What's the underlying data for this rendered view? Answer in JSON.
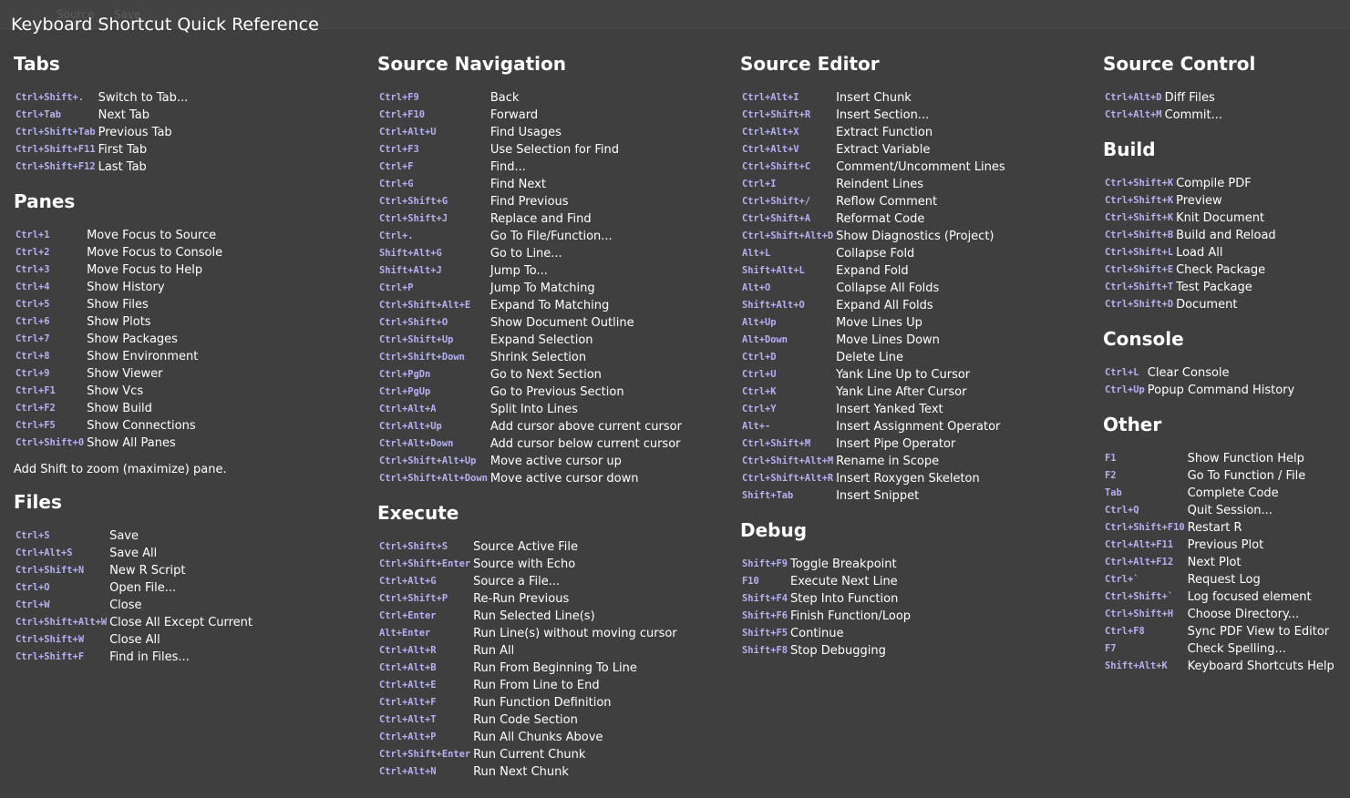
{
  "title": "Keyboard Shortcut Quick Reference",
  "ghost": {
    "source_label": "Source",
    "save_label": "Save"
  },
  "columns": [
    {
      "sections": [
        {
          "title": "Tabs",
          "items": [
            {
              "key": "Ctrl+Shift+.",
              "desc": "Switch to Tab..."
            },
            {
              "key": "Ctrl+Tab",
              "desc": "Next Tab"
            },
            {
              "key": "Ctrl+Shift+Tab",
              "desc": "Previous Tab"
            },
            {
              "key": "Ctrl+Shift+F11",
              "desc": "First Tab"
            },
            {
              "key": "Ctrl+Shift+F12",
              "desc": "Last Tab"
            }
          ]
        },
        {
          "title": "Panes",
          "items": [
            {
              "key": "Ctrl+1",
              "desc": "Move Focus to Source"
            },
            {
              "key": "Ctrl+2",
              "desc": "Move Focus to Console"
            },
            {
              "key": "Ctrl+3",
              "desc": "Move Focus to Help"
            },
            {
              "key": "Ctrl+4",
              "desc": "Show History"
            },
            {
              "key": "Ctrl+5",
              "desc": "Show Files"
            },
            {
              "key": "Ctrl+6",
              "desc": "Show Plots"
            },
            {
              "key": "Ctrl+7",
              "desc": "Show Packages"
            },
            {
              "key": "Ctrl+8",
              "desc": "Show Environment"
            },
            {
              "key": "Ctrl+9",
              "desc": "Show Viewer"
            },
            {
              "key": "Ctrl+F1",
              "desc": "Show Vcs"
            },
            {
              "key": "Ctrl+F2",
              "desc": "Show Build"
            },
            {
              "key": "Ctrl+F5",
              "desc": "Show Connections"
            },
            {
              "key": "Ctrl+Shift+0",
              "desc": "Show All Panes"
            }
          ],
          "note": "Add Shift to zoom (maximize) pane."
        },
        {
          "title": "Files",
          "items": [
            {
              "key": "Ctrl+S",
              "desc": "Save"
            },
            {
              "key": "Ctrl+Alt+S",
              "desc": "Save All"
            },
            {
              "key": "Ctrl+Shift+N",
              "desc": "New R Script"
            },
            {
              "key": "Ctrl+O",
              "desc": "Open File..."
            },
            {
              "key": "Ctrl+W",
              "desc": "Close"
            },
            {
              "key": "Ctrl+Shift+Alt+W",
              "desc": "Close All Except Current"
            },
            {
              "key": "Ctrl+Shift+W",
              "desc": "Close All"
            },
            {
              "key": "Ctrl+Shift+F",
              "desc": "Find in Files..."
            }
          ]
        }
      ]
    },
    {
      "sections": [
        {
          "title": "Source Navigation",
          "items": [
            {
              "key": "Ctrl+F9",
              "desc": "Back"
            },
            {
              "key": "Ctrl+F10",
              "desc": "Forward"
            },
            {
              "key": "Ctrl+Alt+U",
              "desc": "Find Usages"
            },
            {
              "key": "Ctrl+F3",
              "desc": "Use Selection for Find"
            },
            {
              "key": "Ctrl+F",
              "desc": "Find..."
            },
            {
              "key": "Ctrl+G",
              "desc": "Find Next"
            },
            {
              "key": "Ctrl+Shift+G",
              "desc": "Find Previous"
            },
            {
              "key": "Ctrl+Shift+J",
              "desc": "Replace and Find"
            },
            {
              "key": "Ctrl+.",
              "desc": "Go To File/Function..."
            },
            {
              "key": "Shift+Alt+G",
              "desc": "Go to Line..."
            },
            {
              "key": "Shift+Alt+J",
              "desc": "Jump To..."
            },
            {
              "key": "Ctrl+P",
              "desc": "Jump To Matching"
            },
            {
              "key": "Ctrl+Shift+Alt+E",
              "desc": "Expand To Matching"
            },
            {
              "key": "Ctrl+Shift+O",
              "desc": "Show Document Outline"
            },
            {
              "key": "Ctrl+Shift+Up",
              "desc": "Expand Selection"
            },
            {
              "key": "Ctrl+Shift+Down",
              "desc": "Shrink Selection"
            },
            {
              "key": "Ctrl+PgDn",
              "desc": "Go to Next Section"
            },
            {
              "key": "Ctrl+PgUp",
              "desc": "Go to Previous Section"
            },
            {
              "key": "Ctrl+Alt+A",
              "desc": "Split Into Lines"
            },
            {
              "key": "Ctrl+Alt+Up",
              "desc": "Add cursor above current cursor"
            },
            {
              "key": "Ctrl+Alt+Down",
              "desc": "Add cursor below current cursor"
            },
            {
              "key": "Ctrl+Shift+Alt+Up",
              "desc": "Move active cursor up"
            },
            {
              "key": "Ctrl+Shift+Alt+Down",
              "desc": "Move active cursor down"
            }
          ]
        },
        {
          "title": "Execute",
          "items": [
            {
              "key": "Ctrl+Shift+S",
              "desc": "Source Active File"
            },
            {
              "key": "Ctrl+Shift+Enter",
              "desc": "Source with Echo"
            },
            {
              "key": "Ctrl+Alt+G",
              "desc": "Source a File..."
            },
            {
              "key": "Ctrl+Shift+P",
              "desc": "Re-Run Previous"
            },
            {
              "key": "Ctrl+Enter",
              "desc": "Run Selected Line(s)"
            },
            {
              "key": "Alt+Enter",
              "desc": "Run Line(s) without moving cursor"
            },
            {
              "key": "Ctrl+Alt+R",
              "desc": "Run All"
            },
            {
              "key": "Ctrl+Alt+B",
              "desc": "Run From Beginning To Line"
            },
            {
              "key": "Ctrl+Alt+E",
              "desc": "Run From Line to End"
            },
            {
              "key": "Ctrl+Alt+F",
              "desc": "Run Function Definition"
            },
            {
              "key": "Ctrl+Alt+T",
              "desc": "Run Code Section"
            },
            {
              "key": "Ctrl+Alt+P",
              "desc": "Run All Chunks Above"
            },
            {
              "key": "Ctrl+Shift+Enter",
              "desc": "Run Current Chunk"
            },
            {
              "key": "Ctrl+Alt+N",
              "desc": "Run Next Chunk"
            }
          ]
        }
      ]
    },
    {
      "sections": [
        {
          "title": "Source Editor",
          "items": [
            {
              "key": "Ctrl+Alt+I",
              "desc": "Insert Chunk"
            },
            {
              "key": "Ctrl+Shift+R",
              "desc": "Insert Section..."
            },
            {
              "key": "Ctrl+Alt+X",
              "desc": "Extract Function"
            },
            {
              "key": "Ctrl+Alt+V",
              "desc": "Extract Variable"
            },
            {
              "key": "Ctrl+Shift+C",
              "desc": "Comment/Uncomment Lines"
            },
            {
              "key": "Ctrl+I",
              "desc": "Reindent Lines"
            },
            {
              "key": "Ctrl+Shift+/",
              "desc": "Reflow Comment"
            },
            {
              "key": "Ctrl+Shift+A",
              "desc": "Reformat Code"
            },
            {
              "key": "Ctrl+Shift+Alt+D",
              "desc": "Show Diagnostics (Project)"
            },
            {
              "key": "Alt+L",
              "desc": "Collapse Fold"
            },
            {
              "key": "Shift+Alt+L",
              "desc": "Expand Fold"
            },
            {
              "key": "Alt+O",
              "desc": "Collapse All Folds"
            },
            {
              "key": "Shift+Alt+O",
              "desc": "Expand All Folds"
            },
            {
              "key": "Alt+Up",
              "desc": "Move Lines Up"
            },
            {
              "key": "Alt+Down",
              "desc": "Move Lines Down"
            },
            {
              "key": "Ctrl+D",
              "desc": "Delete Line"
            },
            {
              "key": "Ctrl+U",
              "desc": "Yank Line Up to Cursor"
            },
            {
              "key": "Ctrl+K",
              "desc": "Yank Line After Cursor"
            },
            {
              "key": "Ctrl+Y",
              "desc": "Insert Yanked Text"
            },
            {
              "key": "Alt+-",
              "desc": "Insert Assignment Operator"
            },
            {
              "key": "Ctrl+Shift+M",
              "desc": "Insert Pipe Operator"
            },
            {
              "key": "Ctrl+Shift+Alt+M",
              "desc": "Rename in Scope"
            },
            {
              "key": "Ctrl+Shift+Alt+R",
              "desc": "Insert Roxygen Skeleton"
            },
            {
              "key": "Shift+Tab",
              "desc": "Insert Snippet"
            }
          ]
        },
        {
          "title": "Debug",
          "items": [
            {
              "key": "Shift+F9",
              "desc": "Toggle Breakpoint"
            },
            {
              "key": "F10",
              "desc": "Execute Next Line"
            },
            {
              "key": "Shift+F4",
              "desc": "Step Into Function"
            },
            {
              "key": "Shift+F6",
              "desc": "Finish Function/Loop"
            },
            {
              "key": "Shift+F5",
              "desc": "Continue"
            },
            {
              "key": "Shift+F8",
              "desc": "Stop Debugging"
            }
          ]
        }
      ]
    },
    {
      "sections": [
        {
          "title": "Source Control",
          "items": [
            {
              "key": "Ctrl+Alt+D",
              "desc": "Diff Files"
            },
            {
              "key": "Ctrl+Alt+M",
              "desc": "Commit..."
            }
          ]
        },
        {
          "title": "Build",
          "items": [
            {
              "key": "Ctrl+Shift+K",
              "desc": "Compile PDF"
            },
            {
              "key": "Ctrl+Shift+K",
              "desc": "Preview"
            },
            {
              "key": "Ctrl+Shift+K",
              "desc": "Knit Document"
            },
            {
              "key": "Ctrl+Shift+B",
              "desc": "Build and Reload"
            },
            {
              "key": "Ctrl+Shift+L",
              "desc": "Load All"
            },
            {
              "key": "Ctrl+Shift+E",
              "desc": "Check Package"
            },
            {
              "key": "Ctrl+Shift+T",
              "desc": "Test Package"
            },
            {
              "key": "Ctrl+Shift+D",
              "desc": "Document"
            }
          ]
        },
        {
          "title": "Console",
          "items": [
            {
              "key": "Ctrl+L",
              "desc": "Clear Console"
            },
            {
              "key": "Ctrl+Up",
              "desc": "Popup Command History"
            }
          ]
        },
        {
          "title": "Other",
          "items": [
            {
              "key": "F1",
              "desc": "Show Function Help"
            },
            {
              "key": "F2",
              "desc": "Go To Function / File"
            },
            {
              "key": "Tab",
              "desc": "Complete Code"
            },
            {
              "key": "Ctrl+Q",
              "desc": "Quit Session..."
            },
            {
              "key": "Ctrl+Shift+F10",
              "desc": "Restart R"
            },
            {
              "key": "Ctrl+Alt+F11",
              "desc": "Previous Plot"
            },
            {
              "key": "Ctrl+Alt+F12",
              "desc": "Next Plot"
            },
            {
              "key": "Ctrl+`",
              "desc": "Request Log"
            },
            {
              "key": "Ctrl+Shift+`",
              "desc": "Log focused element"
            },
            {
              "key": "Ctrl+Shift+H",
              "desc": "Choose Directory..."
            },
            {
              "key": "Ctrl+F8",
              "desc": "Sync PDF View to Editor"
            },
            {
              "key": "F7",
              "desc": "Check Spelling..."
            },
            {
              "key": "Shift+Alt+K",
              "desc": "Keyboard Shortcuts Help"
            }
          ]
        }
      ]
    }
  ]
}
